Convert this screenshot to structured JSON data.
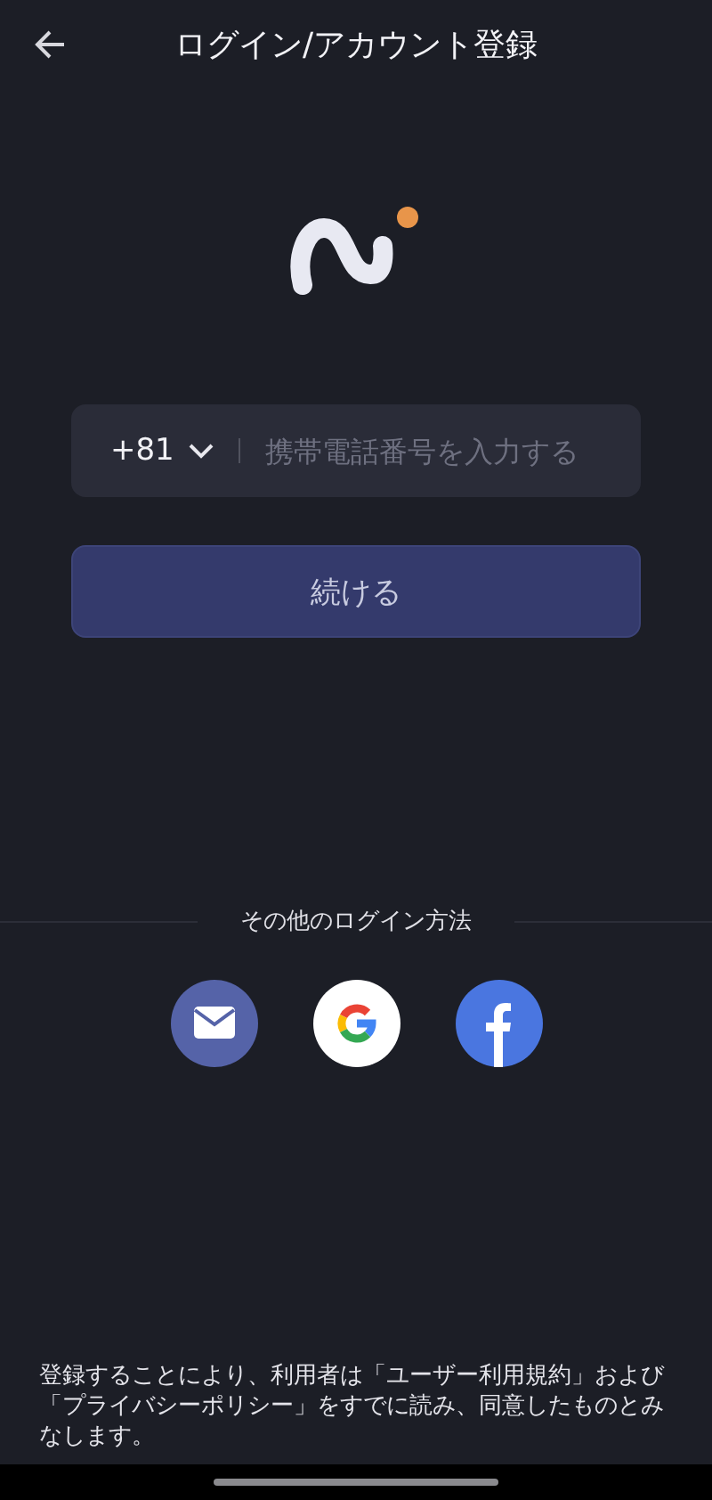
{
  "header": {
    "title": "ログイン/アカウント登録"
  },
  "phone": {
    "country_code": "+81",
    "placeholder": "携帯電話番号を入力する"
  },
  "continue_button": "続ける",
  "other_login": {
    "label": "その他のログイン方法",
    "methods": [
      {
        "kind": "email"
      },
      {
        "kind": "google"
      },
      {
        "kind": "facebook"
      }
    ]
  },
  "terms": "登録することにより、利用者は「ユーザー利用規約」および「プライバシーポリシー」をすでに読み、同意したものとみなします。"
}
